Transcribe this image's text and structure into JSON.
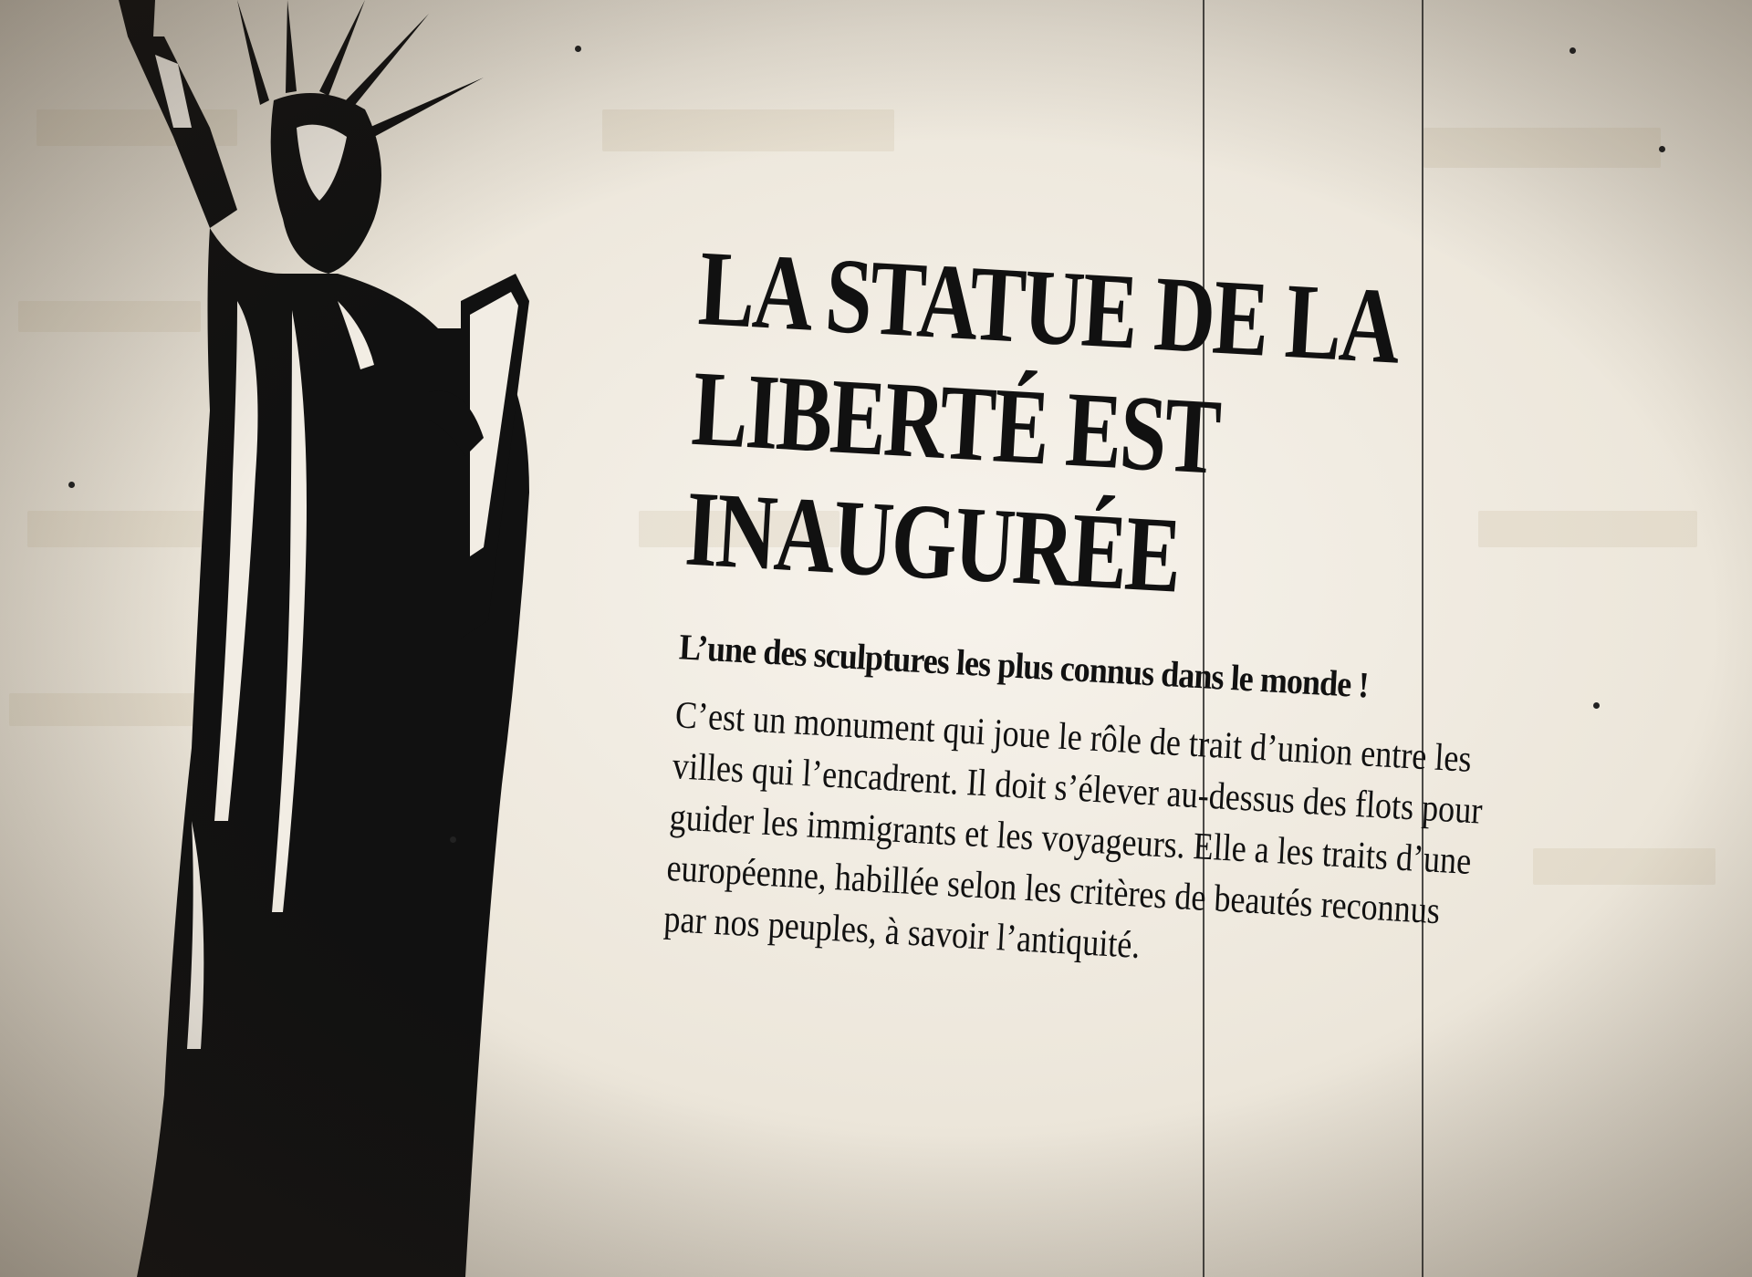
{
  "headline": {
    "line1": "LA STATUE DE LA",
    "line2": "LIBERTÉ EST",
    "line3": "INAUGURÉE"
  },
  "subheadline": "L’une des sculptures les plus connus dans le monde !",
  "body_lines": [
    "C’est un monument qui joue le rôle de trait d’union entre les",
    "villes qui l’encadrent. Il doit s’élever au-dessus des flots pour",
    "guider les immigrants et les voyageurs.  Elle a les traits d’une",
    "européenne, habillée selon les critères de beautés reconnus",
    "par nos peuples, à savoir l’antiquité."
  ],
  "illustration": "statue-of-liberty",
  "colors": {
    "ink": "#111111",
    "paper": "#f2ede4"
  }
}
